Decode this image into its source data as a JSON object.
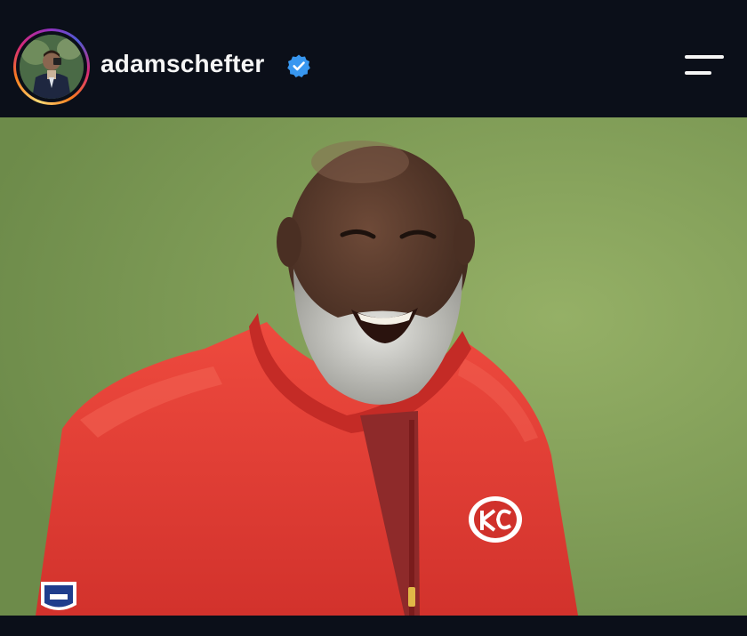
{
  "post_header": {
    "username": "adamschefter",
    "avatar_icon": "profile-avatar",
    "verified_icon": "verified-badge-icon",
    "menu_icon": "menu-icon"
  },
  "post_media": {
    "kind": "photo",
    "brand_colors": {
      "jacket_red": "#e0352f",
      "background_green": "#7d9a55",
      "header_bg": "#0b0f19",
      "verified_blue": "#3897f0"
    }
  }
}
